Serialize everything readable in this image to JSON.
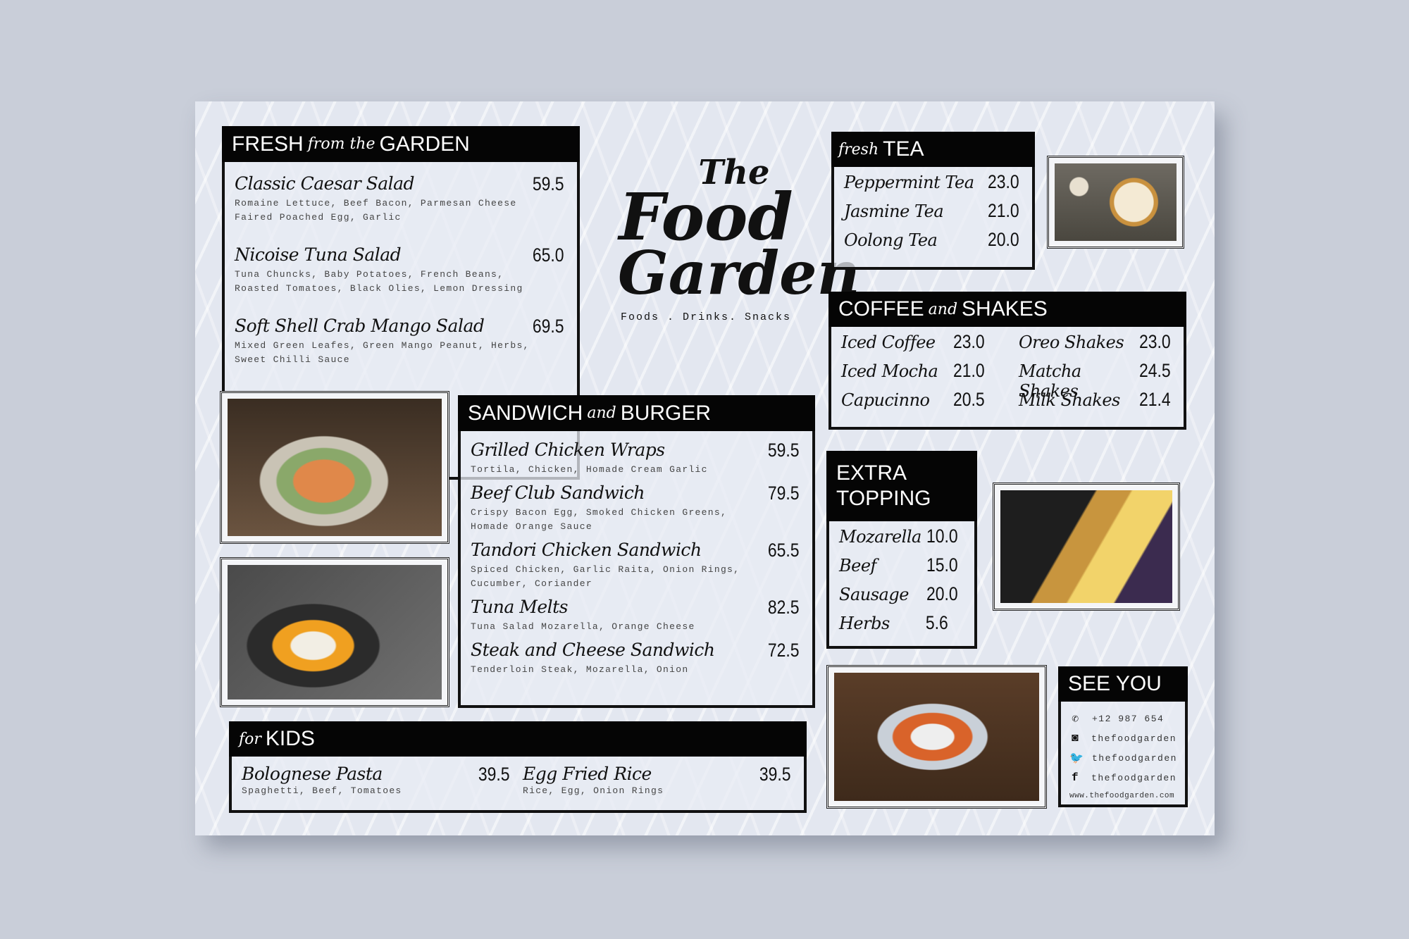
{
  "title": {
    "line1": "The",
    "line2": "Food",
    "line3": "Garden",
    "tagline": "Foods . Drinks. Snacks"
  },
  "fresh": {
    "h1": "FRESH",
    "h2": "from the",
    "h3": "GARDEN",
    "items": [
      {
        "name": "Classic Caesar Salad",
        "price": "59.5",
        "desc": "Romaine Lettuce, Beef Bacon, Parmesan Cheese Faired Poached Egg, Garlic"
      },
      {
        "name": "Nicoise Tuna Salad",
        "price": "65.0",
        "desc": "Tuna Chuncks, Baby Potatoes, French Beans, Roasted Tomatoes, Black Olies, Lemon Dressing"
      },
      {
        "name": "Soft Shell Crab Mango Salad",
        "price": "69.5",
        "desc": "Mixed Green Leafes, Green Mango Peanut, Herbs, Sweet Chilli Sauce"
      }
    ]
  },
  "sandwich": {
    "h1": "SANDWICH",
    "h2": "and",
    "h3": "BURGER",
    "items": [
      {
        "name": "Grilled Chicken Wraps",
        "price": "59.5",
        "desc": "Tortila, Chicken, Homade Cream Garlic"
      },
      {
        "name": "Beef Club Sandwich",
        "price": "79.5",
        "desc": "Crispy Bacon Egg, Smoked Chicken Greens, Homade Orange Sauce"
      },
      {
        "name": "Tandori Chicken Sandwich",
        "price": "65.5",
        "desc": "Spiced Chicken, Garlic Raita, Onion Rings, Cucumber, Coriander"
      },
      {
        "name": "Tuna Melts",
        "price": "82.5",
        "desc": "Tuna Salad Mozarella, Orange Cheese"
      },
      {
        "name": "Steak and Cheese Sandwich",
        "price": "72.5",
        "desc": "Tenderloin Steak, Mozarella, Onion"
      }
    ]
  },
  "kids": {
    "h1": "for",
    "h2": "KIDS",
    "items": [
      {
        "name": "Bolognese Pasta",
        "price": "39.5",
        "desc": "Spaghetti, Beef, Tomatoes"
      },
      {
        "name": "Egg Fried Rice",
        "price": "39.5",
        "desc": "Rice, Egg, Onion Rings"
      }
    ]
  },
  "tea": {
    "h1": "fresh",
    "h2": "TEA",
    "items": [
      {
        "name": "Peppermint Tea",
        "price": "23.0"
      },
      {
        "name": "Jasmine Tea",
        "price": "21.0"
      },
      {
        "name": "Oolong Tea",
        "price": "20.0"
      }
    ]
  },
  "coffee": {
    "h1": "COFFEE",
    "h2": "and",
    "h3": "SHAKES",
    "left": [
      {
        "name": "Iced Coffee",
        "price": "23.0"
      },
      {
        "name": "Iced Mocha",
        "price": "21.0"
      },
      {
        "name": "Capucinno",
        "price": "20.5"
      }
    ],
    "right": [
      {
        "name": "Oreo Shakes",
        "price": "23.0"
      },
      {
        "name": "Matcha Shakes",
        "price": "24.5"
      },
      {
        "name": "Milk Shakes",
        "price": "21.4"
      }
    ]
  },
  "topping": {
    "h1": "EXTRA",
    "h2": "TOPPING",
    "items": [
      {
        "name": "Mozarella",
        "price": "10.0"
      },
      {
        "name": "Beef",
        "price": "15.0"
      },
      {
        "name": "Sausage",
        "price": "20.0"
      },
      {
        "name": "Herbs",
        "price": "5.6"
      }
    ]
  },
  "contact": {
    "heading": "SEE YOU",
    "phone": "+12 987 654",
    "instagram": "thefoodgarden",
    "twitter": "thefoodgarden",
    "facebook": "thefoodgarden",
    "website": "www.thefoodgarden.com"
  },
  "icons": [
    "whatsapp-icon",
    "instagram-icon",
    "twitter-icon",
    "facebook-icon"
  ]
}
